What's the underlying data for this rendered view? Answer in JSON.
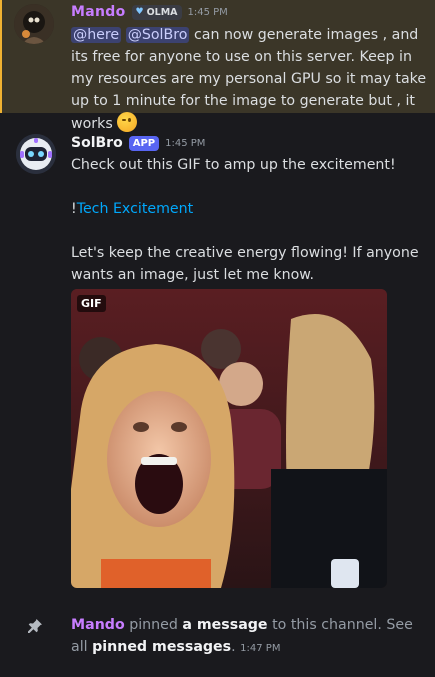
{
  "message1": {
    "username": "Mando",
    "guild_tag": "OLMA",
    "timestamp": "1:45 PM",
    "mention_here": "@here",
    "mention_bot": "@SolBro",
    "text": " can now generate images , and its free for anyone to use on this server. Keep in my resources are my personal GPU so it may take up to 1 minute for the image to generate but , it works ",
    "emoji_icon": "winking-face-emoji"
  },
  "message2": {
    "username": "SolBro",
    "bot_tag": "APP",
    "timestamp": "1:45 PM",
    "line1": "Check out this GIF to amp up the excitement!",
    "link_prefix": "!",
    "link_text": "Tech Excitement",
    "line3": "Let's keep the creative energy flowing! If anyone wants an image, just let me know.",
    "gif_badge": "GIF"
  },
  "system": {
    "username": "Mando",
    "text1": " pinned ",
    "a_message": "a message",
    "text2": " to this channel. See all ",
    "pinned_messages": "pinned messages",
    "text3": ".",
    "timestamp": "1:47 PM",
    "icon": "pin-icon"
  },
  "colors": {
    "background": "#1a1a1e",
    "highlight": "#3b3628",
    "mando_name": "#c77dff",
    "link": "#00a8fc",
    "app_tag": "#5865f2"
  }
}
